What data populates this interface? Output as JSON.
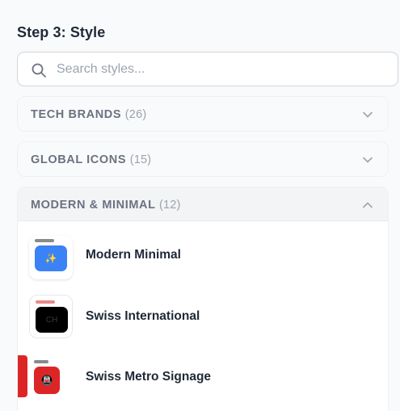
{
  "step": {
    "title": "Step 3: Style"
  },
  "search": {
    "placeholder": "Search styles..."
  },
  "sections": [
    {
      "name": "TECH BRANDS",
      "count": "(26)",
      "expanded": false
    },
    {
      "name": "GLOBAL ICONS",
      "count": "(15)",
      "expanded": false
    },
    {
      "name": "MODERN & MINIMAL",
      "count": "(12)",
      "expanded": true,
      "items": [
        {
          "label": "Modern Minimal",
          "icon": "sparkles-icon",
          "glyph": "✨",
          "tile_color": "#3b82f6",
          "bar_color": "#8a8a8a"
        },
        {
          "label": "Swiss International",
          "icon": "ch-icon",
          "glyph": "CH",
          "tile_color": "#000000",
          "bar_color": "#e88a8a"
        },
        {
          "label": "Swiss Metro Signage",
          "icon": "metro-train-icon",
          "glyph": "🚇",
          "tile_color": "#dc2626",
          "bar_color": "#8a8a8a"
        }
      ]
    }
  ],
  "colors": {
    "accent_red": "#dc2626",
    "accent_blue": "#3b82f6",
    "text_muted": "#6b7280"
  }
}
